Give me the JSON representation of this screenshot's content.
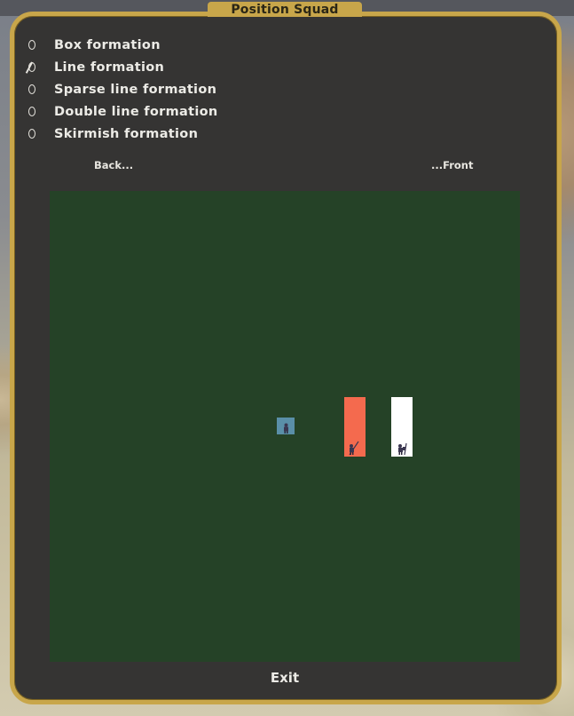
{
  "window": {
    "title": "Position Squad"
  },
  "formations": [
    {
      "label": "Box formation",
      "selected": false
    },
    {
      "label": "Line formation",
      "selected": true
    },
    {
      "label": "Sparse line formation",
      "selected": false
    },
    {
      "label": "Double line formation",
      "selected": false
    },
    {
      "label": "Skirmish formation",
      "selected": false
    }
  ],
  "field": {
    "back_label": "Back...",
    "front_label": "...Front",
    "background_color": "#254227",
    "units": [
      {
        "id": "unit-blue",
        "color": "#5a8fa8",
        "icon": "soldier-icon"
      },
      {
        "id": "unit-red",
        "color": "#f46a4e",
        "icon": "soldier-icon"
      },
      {
        "id": "unit-white",
        "color": "#ffffff",
        "icon": "soldier-icon"
      }
    ]
  },
  "footer": {
    "exit_label": "Exit"
  },
  "colors": {
    "frame": "#c8a64a",
    "panel": "#353433",
    "text": "#ecebe6"
  }
}
